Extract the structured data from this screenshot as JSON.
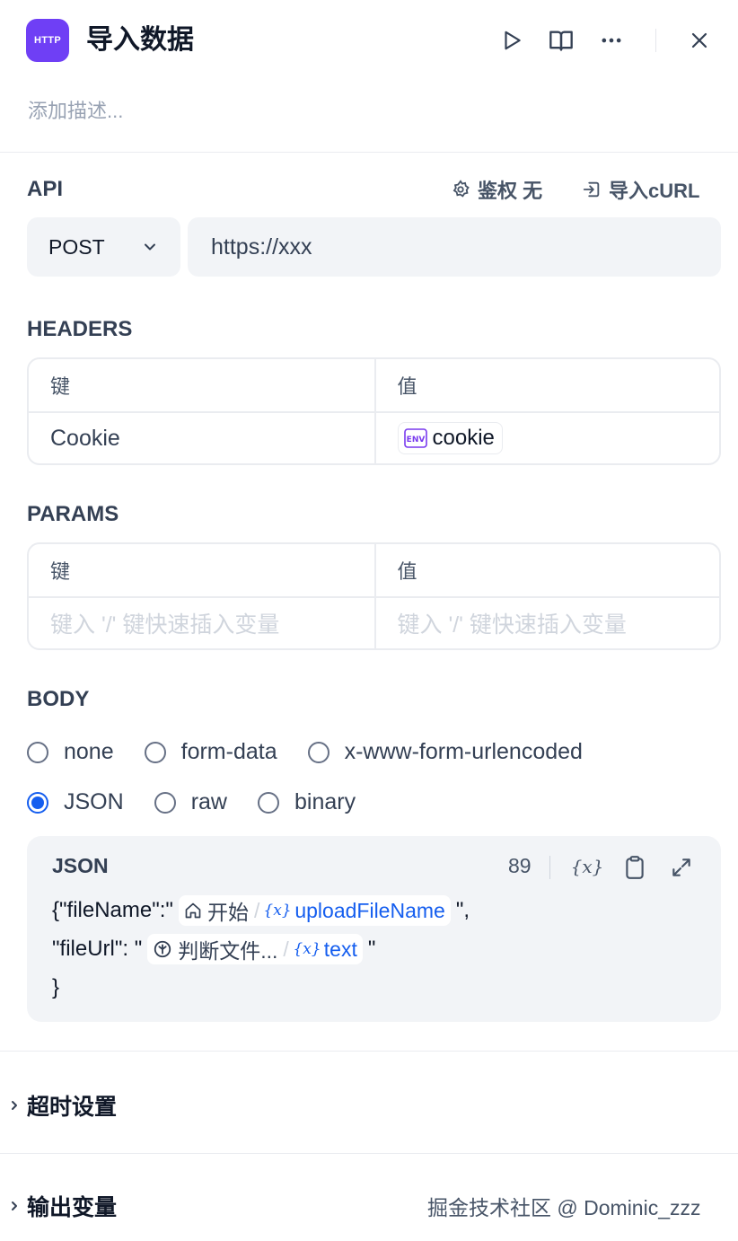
{
  "header": {
    "app_icon_text": "HTTP",
    "title": "导入数据",
    "description_placeholder": "添加描述..."
  },
  "api": {
    "section_title": "API",
    "auth_label": "鉴权 无",
    "import_curl_label": "导入cURL",
    "method": "POST",
    "url": "https://xxx"
  },
  "headers": {
    "section_title": "HEADERS",
    "key_col": "键",
    "value_col": "值",
    "rows": [
      {
        "key": "Cookie",
        "value_badge": "ENV",
        "value": "cookie"
      }
    ]
  },
  "params": {
    "section_title": "PARAMS",
    "key_col": "键",
    "value_col": "值",
    "key_placeholder": "键入 '/' 键快速插入变量",
    "value_placeholder": "键入 '/' 键快速插入变量"
  },
  "body": {
    "section_title": "BODY",
    "options": [
      "none",
      "form-data",
      "x-www-form-urlencoded",
      "JSON",
      "raw",
      "binary"
    ],
    "selected": "JSON",
    "json_editor": {
      "title": "JSON",
      "count": "89",
      "line1_prefix": "{\"fileName\":\"",
      "line1_node": "开始",
      "line1_var": "uploadFileName",
      "line1_suffix": "\",",
      "line2_prefix": "\"fileUrl\": \"",
      "line2_node": "判断文件...",
      "line2_var": "text",
      "line2_suffix": "\"",
      "line3": "}"
    }
  },
  "sections": {
    "timeout": "超时设置",
    "output_vars": "输出变量"
  },
  "watermark": "掘金技术社区 @ Dominic_zzz",
  "colors": {
    "brand": "#6f3ff5",
    "accent": "#155eef"
  }
}
